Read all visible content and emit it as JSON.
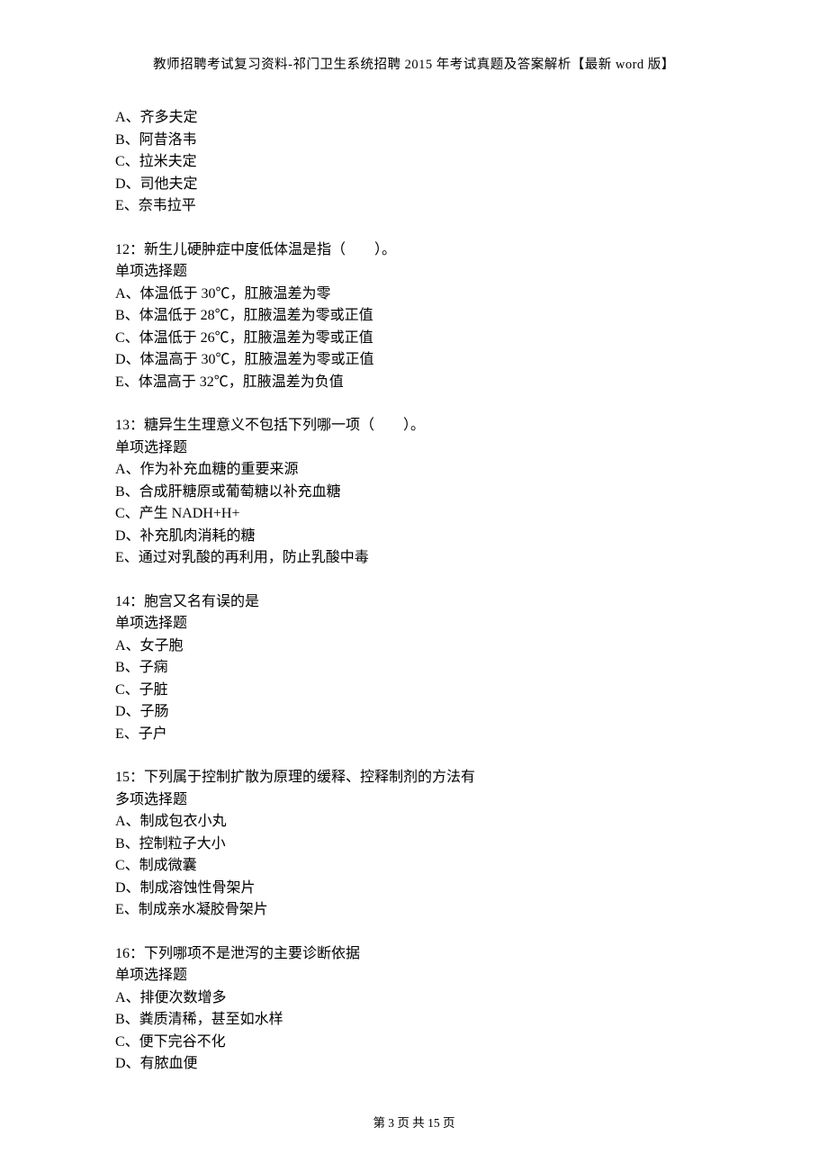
{
  "header": {
    "title": "教师招聘考试复习资料-祁门卫生系统招聘 2015 年考试真题及答案解析【最新 word 版】"
  },
  "partial_options": {
    "items": [
      "A、齐多夫定",
      "B、阿昔洛韦",
      "C、拉米夫定",
      "D、司他夫定",
      "E、奈韦拉平"
    ]
  },
  "questions": [
    {
      "stem": "12：新生儿硬肿症中度低体温是指（　　）。",
      "type": "单项选择题",
      "options": [
        "A、体温低于 30℃，肛腋温差为零",
        "B、体温低于 28℃，肛腋温差为零或正值",
        "C、体温低于 26℃，肛腋温差为零或正值",
        "D、体温高于 30℃，肛腋温差为零或正值",
        "E、体温高于 32℃，肛腋温差为负值"
      ]
    },
    {
      "stem": "13：糖异生生理意义不包括下列哪一项（　　）。",
      "type": "单项选择题",
      "options": [
        "A、作为补充血糖的重要来源",
        "B、合成肝糖原或葡萄糖以补充血糖",
        "C、产生 NADH+H+",
        "D、补充肌肉消耗的糖",
        "E、通过对乳酸的再利用，防止乳酸中毒"
      ]
    },
    {
      "stem": "14：胞宫又名有误的是",
      "type": "单项选择题",
      "options": [
        "A、女子胞",
        "B、子痫",
        "C、子脏",
        "D、子肠",
        "E、子户"
      ]
    },
    {
      "stem": "15：下列属于控制扩散为原理的缓释、控释制剂的方法有",
      "type": "多项选择题",
      "options": [
        "A、制成包衣小丸",
        "B、控制粒子大小",
        "C、制成微囊",
        "D、制成溶蚀性骨架片",
        "E、制成亲水凝胶骨架片"
      ]
    },
    {
      "stem": "16：下列哪项不是泄泻的主要诊断依据",
      "type": "单项选择题",
      "options": [
        "A、排便次数增多",
        "B、粪质清稀，甚至如水样",
        "C、便下完谷不化",
        "D、有脓血便"
      ]
    }
  ],
  "footer": {
    "text": "第 3 页 共 15 页"
  }
}
